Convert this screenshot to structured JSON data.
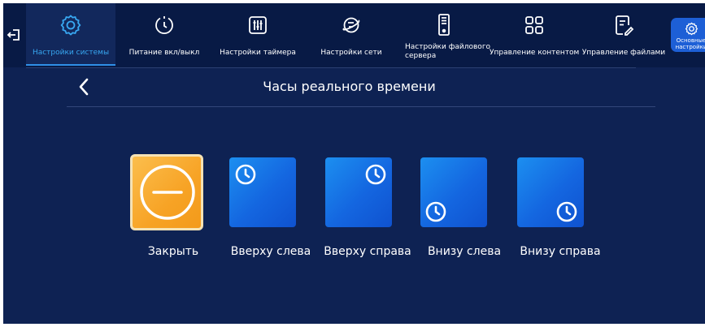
{
  "nav": {
    "items": [
      {
        "label": "Настройки системы",
        "icon": "gear-icon",
        "active": true
      },
      {
        "label": "Питание вкл/выкл",
        "icon": "power-timer-icon"
      },
      {
        "label": "Настройки таймера",
        "icon": "sliders-icon"
      },
      {
        "label": "Настройки сети",
        "icon": "network-globe-icon"
      },
      {
        "label": "Настройки файлового сервера",
        "label_line1": "Настройки файлового",
        "label_line2": "сервера",
        "icon": "file-server-icon"
      },
      {
        "label": "Управление контентом",
        "icon": "grid-icon"
      },
      {
        "label": "Управление файлами",
        "icon": "file-edit-icon"
      }
    ],
    "side_button": {
      "line1": "Основные",
      "line2": "настройки",
      "icon": "gear-icon"
    },
    "active_color": "#38a8f2"
  },
  "page": {
    "title": "Часы реального времени"
  },
  "options": [
    {
      "label": "Закрыть",
      "variant": "close",
      "color": "#f7a325"
    },
    {
      "label": "Вверху слева",
      "variant": "top-left",
      "color": "#1466e0"
    },
    {
      "label": "Вверху справа",
      "variant": "top-right",
      "color": "#1466e0"
    },
    {
      "label": "Внизу слева",
      "variant": "bottom-left",
      "color": "#1466e0"
    },
    {
      "label": "Внизу справа",
      "variant": "bottom-right",
      "color": "#1466e0"
    }
  ]
}
